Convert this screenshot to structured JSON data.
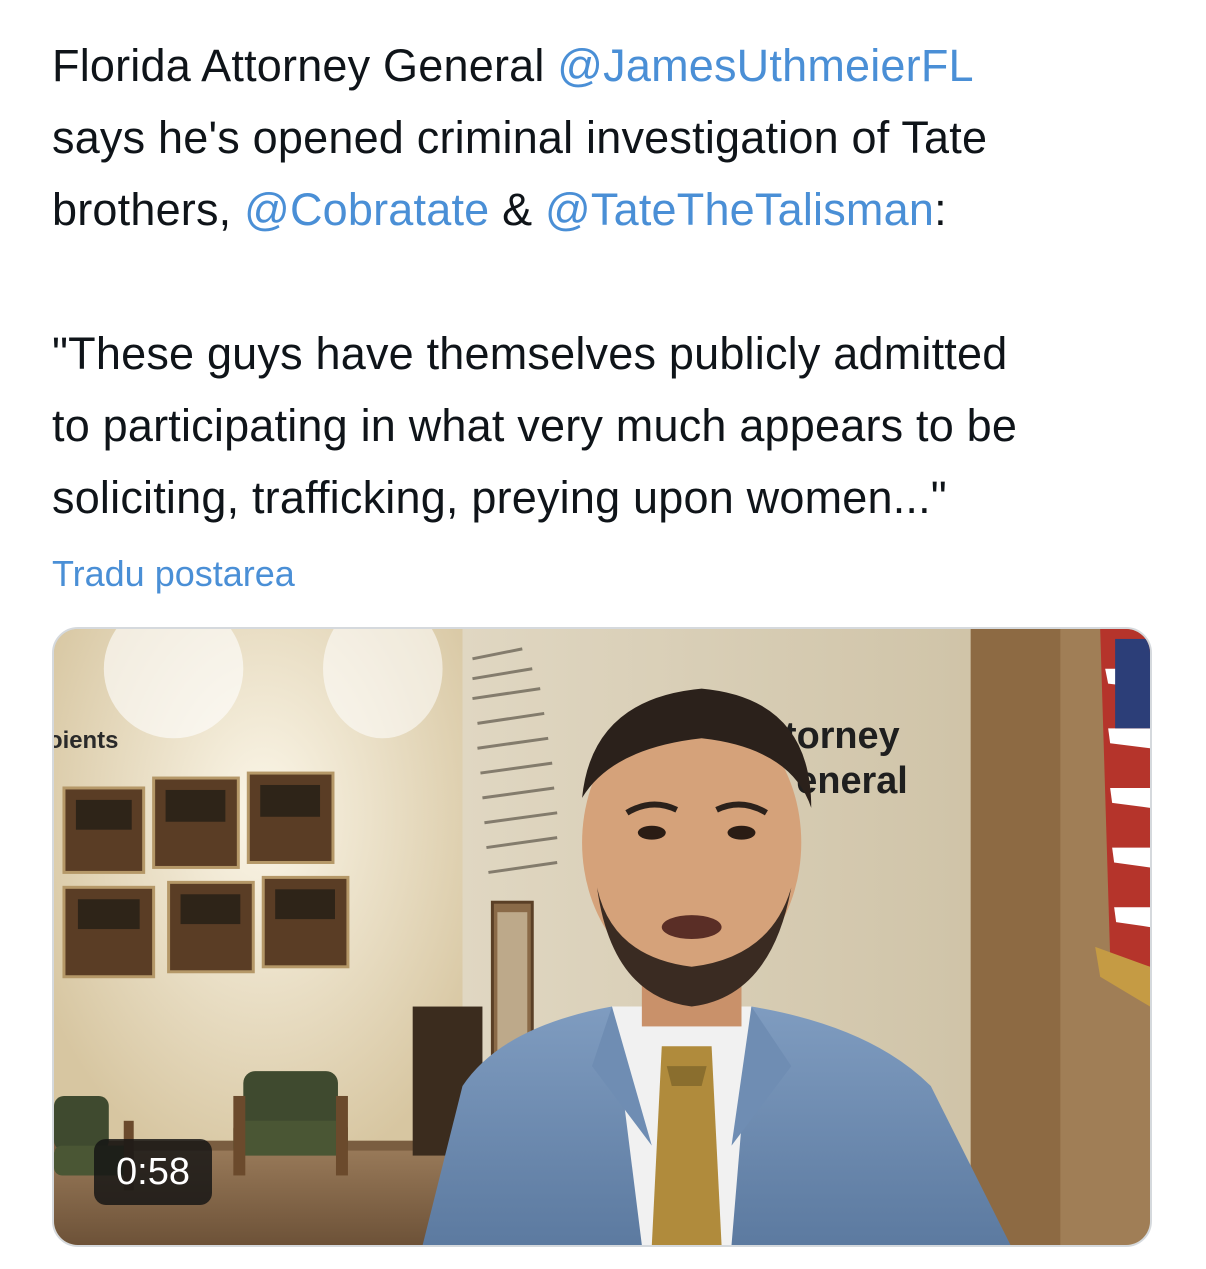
{
  "tweet": {
    "text_line1_prefix": "Florida Attorney General ",
    "mention_ag": "@JamesUthmeierFL",
    "text_line2": "says he's opened criminal investigation of Tate",
    "text_line3_prefix": "brothers, ",
    "mention_cobra": "@Cobratate",
    "text_amp": " & ",
    "mention_talisman": "@TateTheTalisman",
    "text_colon": ":",
    "quote_line1": "\"These guys have themselves publicly admitted",
    "quote_line2": "to participating in what very much appears to be",
    "quote_line3": "soliciting, trafficking, preying upon women...\"",
    "translate_label": "Tradu postarea"
  },
  "media": {
    "duration": "0:58",
    "wall_sign_left": "oients",
    "wall_sign_right_1": "ttorney",
    "wall_sign_right_2": "eneral"
  },
  "colors": {
    "link": "#4a8fd6",
    "text": "#0f1419"
  }
}
